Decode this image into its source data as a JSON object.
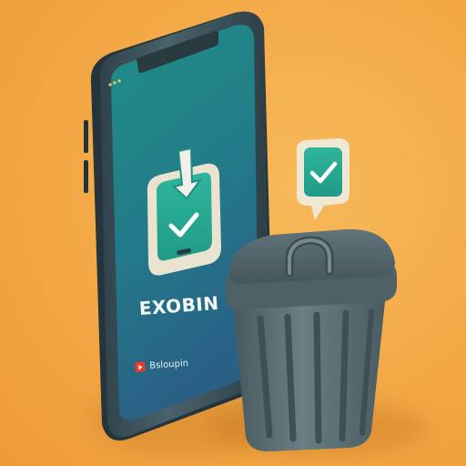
{
  "app": {
    "name": "EXOBIN",
    "store_label": "Bsloupin"
  },
  "icons": {
    "app_icon": "download-to-device-icon",
    "badge_icon": "checkmark-bubble-icon",
    "trash_icon": "trash-can-icon",
    "store_icon": "play-store-icon"
  },
  "colors": {
    "background": "#f3a845",
    "phone_screen_top": "#1f8f86",
    "phone_screen_bottom": "#2a6d8a",
    "phone_frame": "#3a4f58",
    "accent": "#25a38f",
    "trash": "#566a70"
  }
}
